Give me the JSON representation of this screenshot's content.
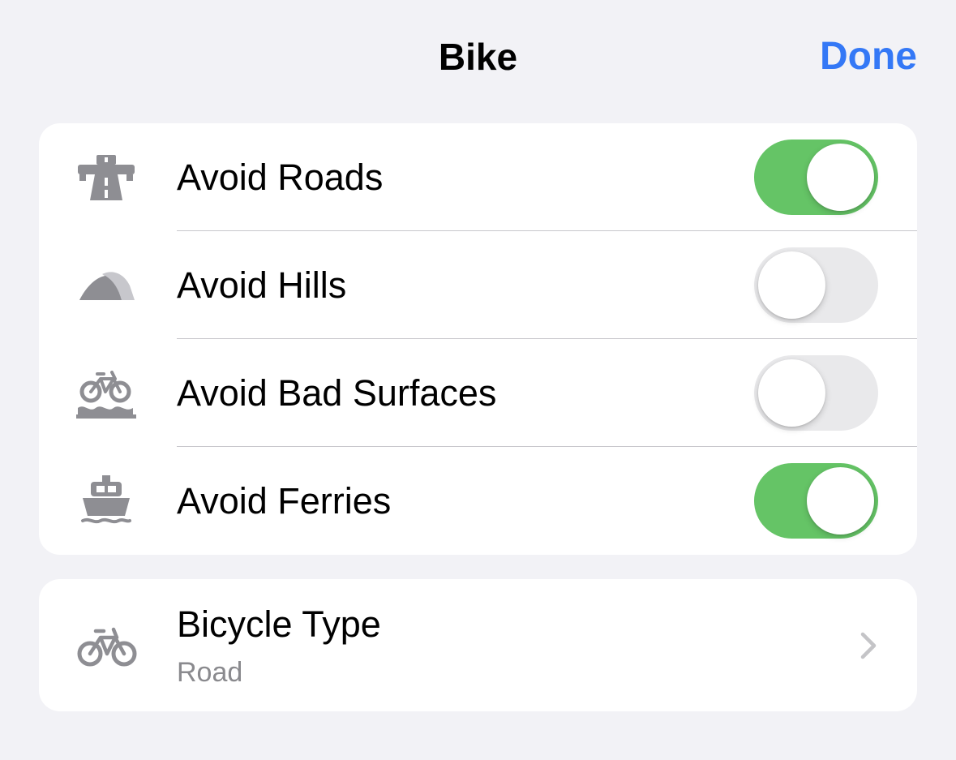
{
  "header": {
    "title": "Bike",
    "done_label": "Done"
  },
  "avoid_options": [
    {
      "label": "Avoid Roads",
      "icon": "highway-icon",
      "enabled": true
    },
    {
      "label": "Avoid Hills",
      "icon": "hills-icon",
      "enabled": false
    },
    {
      "label": "Avoid Bad Surfaces",
      "icon": "bike-rough-surface-icon",
      "enabled": false
    },
    {
      "label": "Avoid Ferries",
      "icon": "ferry-icon",
      "enabled": true
    }
  ],
  "bicycle_type": {
    "title": "Bicycle Type",
    "value": "Road",
    "icon": "bicycle-icon"
  },
  "colors": {
    "accent": "#3478f6",
    "toggle_on": "#65c466",
    "toggle_off": "#e9e9eb",
    "icon_gray": "#8e8e93",
    "background": "#f2f2f6"
  }
}
